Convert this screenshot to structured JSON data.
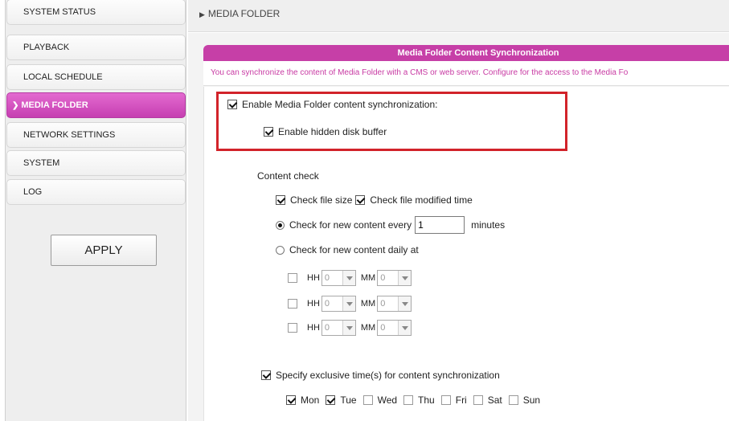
{
  "sidebar": {
    "items": [
      {
        "label": "SYSTEM STATUS"
      },
      {
        "label": "PLAYBACK"
      },
      {
        "label": "LOCAL SCHEDULE"
      },
      {
        "label": "MEDIA FOLDER",
        "active": true
      },
      {
        "label": "NETWORK SETTINGS"
      },
      {
        "label": "SYSTEM"
      },
      {
        "label": "LOG"
      }
    ],
    "apply_label": "APPLY"
  },
  "breadcrumb": "MEDIA FOLDER",
  "panel": {
    "title": "Media Folder Content Synchronization",
    "description": "You can synchronize the content of Media Folder with a CMS or web server. Configure for the access to the Media Fo"
  },
  "sync": {
    "enable_label": "Enable Media Folder content synchronization:",
    "enable_checked": true,
    "buffer_label": "Enable hidden disk buffer",
    "buffer_checked": true
  },
  "content_check": {
    "heading": "Content check",
    "file_size_label": "Check file size",
    "file_size_checked": true,
    "modified_label": "Check file modified time",
    "modified_checked": true,
    "every_label": "Check for new content every",
    "every_value": "1",
    "every_unit": "minutes",
    "daily_label": "Check for new content daily at",
    "times": [
      {
        "hh_label": "HH",
        "hh": "0",
        "mm_label": "MM",
        "mm": "0"
      },
      {
        "hh_label": "HH",
        "hh": "0",
        "mm_label": "MM",
        "mm": "0"
      },
      {
        "hh_label": "HH",
        "hh": "0",
        "mm_label": "MM",
        "mm": "0"
      }
    ]
  },
  "exclusive": {
    "label": "Specify exclusive time(s) for content synchronization",
    "checked": true,
    "days": [
      {
        "label": "Mon",
        "checked": true
      },
      {
        "label": "Tue",
        "checked": true
      },
      {
        "label": "Wed",
        "checked": false
      },
      {
        "label": "Thu",
        "checked": false
      },
      {
        "label": "Fri",
        "checked": false
      },
      {
        "label": "Sat",
        "checked": false
      },
      {
        "label": "Sun",
        "checked": false
      }
    ]
  },
  "colors": {
    "accent": "#c63fa7",
    "highlight": "#d2232a"
  }
}
